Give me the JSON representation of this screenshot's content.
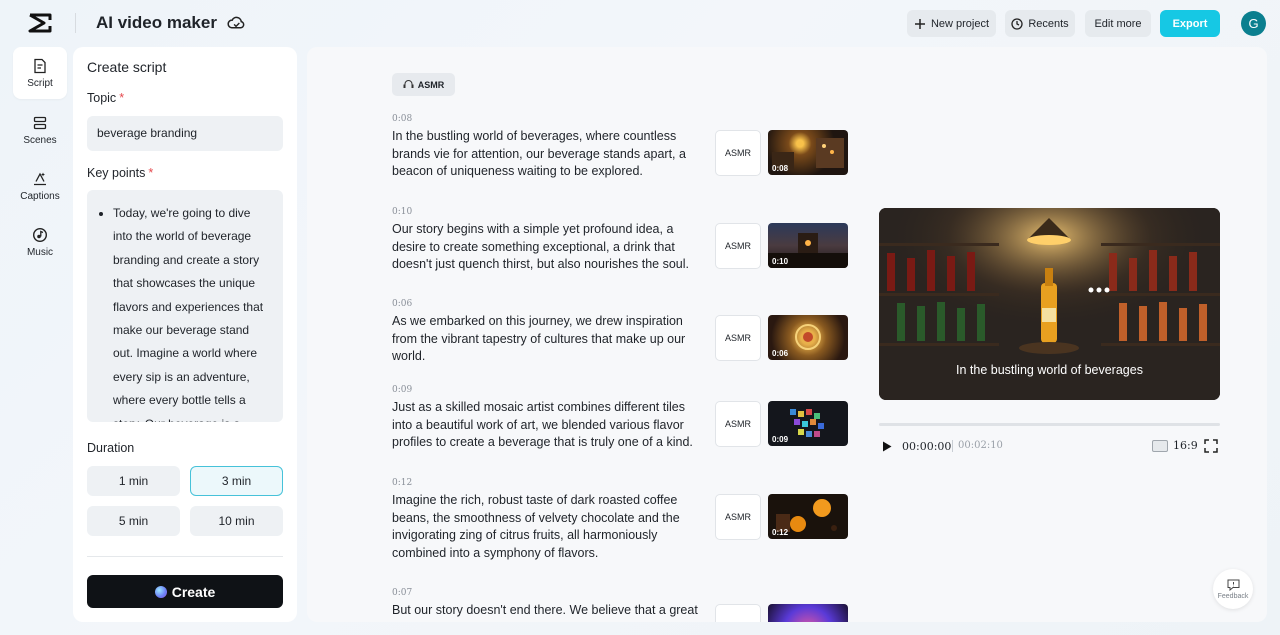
{
  "header": {
    "title": "AI video maker",
    "buttons": {
      "new_project": "New project",
      "recents": "Recents",
      "edit_more": "Edit more",
      "export": "Export"
    },
    "avatar_initial": "G",
    "accent_color": "#16c8e4"
  },
  "nav": {
    "items": [
      {
        "label": "Script",
        "icon": "script-icon"
      },
      {
        "label": "Scenes",
        "icon": "scenes-icon"
      },
      {
        "label": "Captions",
        "icon": "captions-icon"
      },
      {
        "label": "Music",
        "icon": "music-icon"
      }
    ]
  },
  "panel": {
    "title": "Create script",
    "topic_label": "Topic",
    "required_mark": "*",
    "topic_value": "beverage branding",
    "key_points_label": "Key points",
    "key_points_text": "Today, we're going to dive into the world of beverage branding and create a story that showcases the unique flavors and experiences that make our beverage stand out. Imagine a world where every sip is an adventure, where every bottle tells a story. Our beverage is a",
    "duration_label": "Duration",
    "durations": [
      "1 min",
      "3 min",
      "5 min",
      "10 min"
    ],
    "selected_duration": "3 min",
    "create_label": "Create"
  },
  "main": {
    "style_chip": "ASMR",
    "scenes": [
      {
        "time": "0:08",
        "text": "In the bustling world of beverages, where countless brands vie for attention, our beverage stands apart, a beacon of uniqueness waiting to be explored.",
        "audio": "ASMR",
        "thumb_time": "0:08"
      },
      {
        "time": "0:10",
        "text": "Our story begins with a simple yet profound idea, a desire to create something exceptional, a drink that doesn't just quench thirst, but also nourishes the soul.",
        "audio": "ASMR",
        "thumb_time": "0:10"
      },
      {
        "time": "0:06",
        "text": "As we embarked on this journey, we drew inspiration from the vibrant tapestry of cultures that make up our world.",
        "audio": "ASMR",
        "thumb_time": "0:06"
      },
      {
        "time": "0:09",
        "text": "Just as a skilled mosaic artist combines different tiles into a beautiful work of art, we blended various flavor profiles to create a beverage that is truly one of a kind.",
        "audio": "ASMR",
        "thumb_time": "0:09"
      },
      {
        "time": "0:12",
        "text": "Imagine the rich, robust taste of dark roasted coffee beans, the smoothness of velvety chocolate and the invigorating zing of citrus fruits, all harmoniously combined into a symphony of flavors.",
        "audio": "ASMR",
        "thumb_time": "0:12"
      },
      {
        "time": "0:07",
        "text": "But our story doesn't end there. We believe that a great",
        "audio": "",
        "thumb_time": ""
      }
    ]
  },
  "player": {
    "caption": "In the bustling world of beverages",
    "current_time": "00:00:00",
    "total_time": "00:02:10",
    "aspect_ratio": "16:9",
    "progress": 0
  },
  "feedback_label": "Feedback"
}
